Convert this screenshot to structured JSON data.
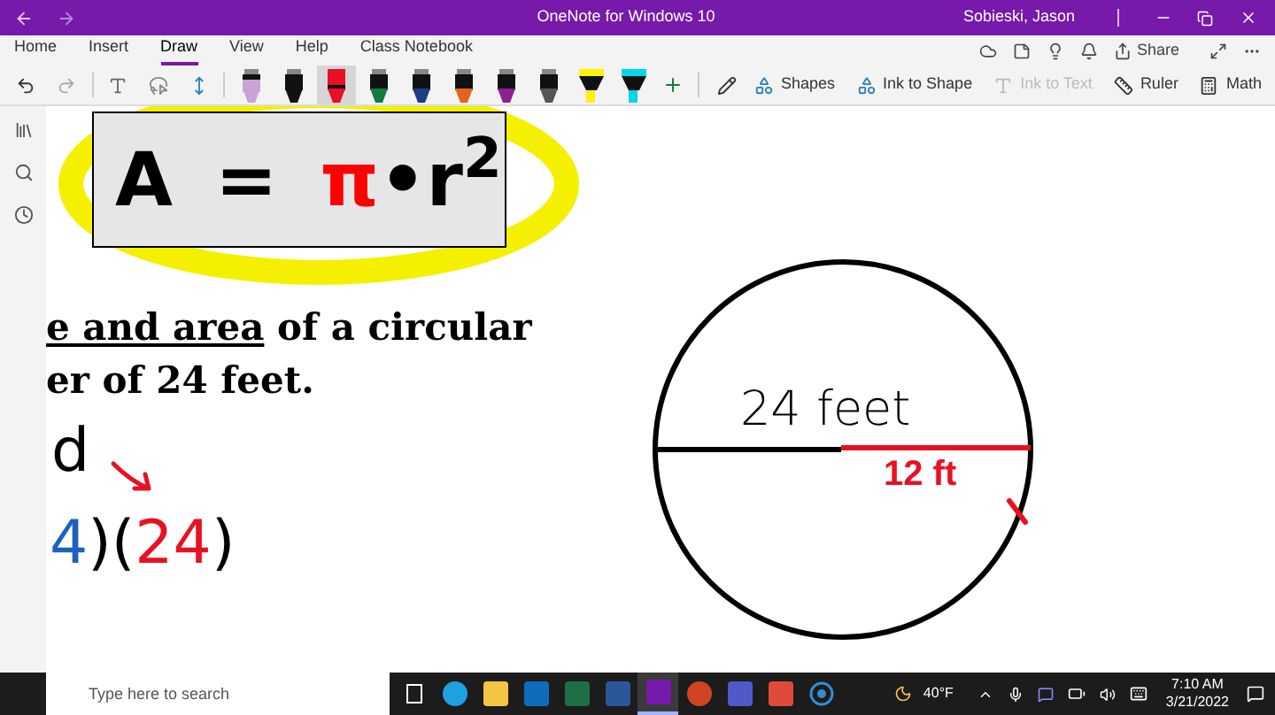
{
  "window": {
    "title": "OneNote for Windows 10",
    "user": "Sobieski, Jason"
  },
  "tabs": [
    {
      "label": "Home",
      "selected": false
    },
    {
      "label": "Insert",
      "selected": false
    },
    {
      "label": "Draw",
      "selected": true
    },
    {
      "label": "View",
      "selected": false
    },
    {
      "label": "Help",
      "selected": false
    },
    {
      "label": "Class Notebook",
      "selected": false
    }
  ],
  "share": {
    "label": "Share"
  },
  "pens": [
    {
      "kind": "pen",
      "color": "#c9a3d6",
      "selected": false
    },
    {
      "kind": "pen",
      "color": "#111111",
      "selected": false
    },
    {
      "kind": "pen",
      "color": "#e81123",
      "selected": true
    },
    {
      "kind": "pen",
      "color": "#107c41",
      "selected": false
    },
    {
      "kind": "pen",
      "color": "#1f3c88",
      "selected": false
    },
    {
      "kind": "pen",
      "color": "#e8631a",
      "selected": false
    },
    {
      "kind": "pen",
      "color": "#8e1f8e",
      "selected": false
    },
    {
      "kind": "pen",
      "color": "#555555",
      "selected": false
    },
    {
      "kind": "highlighter",
      "color": "#fff200",
      "selected": false
    },
    {
      "kind": "highlighter",
      "color": "#00d7e8",
      "selected": false
    }
  ],
  "tools": [
    {
      "label": "Shapes",
      "disabled": false
    },
    {
      "label": "Ink to Shape",
      "disabled": false
    },
    {
      "label": "Ink to Text",
      "disabled": true
    },
    {
      "label": "Ruler",
      "disabled": false
    },
    {
      "label": "Math",
      "disabled": false
    }
  ],
  "formula": {
    "left": "A",
    "equals": "=",
    "pi": "π",
    "rest": "•r$^{2}$"
  },
  "problem": {
    "line1_underlined": "e and area",
    "line1_rest": " of a circular",
    "line2": "er of 24 feet."
  },
  "handwriting": [
    {
      "text": "d",
      "color": "#000000"
    },
    {
      "text": "4",
      "color": "#1f5fbf"
    },
    {
      "text": ")(",
      "color": "#000000"
    },
    {
      "text": "24",
      "color": "#e81123"
    },
    {
      "text": ")",
      "color": "#000000"
    }
  ],
  "circle": {
    "diameter_label": "24 feet",
    "radius_label": "12 ft"
  },
  "taskbar": {
    "search_placeholder": "Type here to search",
    "temperature": "40°F",
    "time": "7:10 AM",
    "date": "3/21/2022",
    "apps": [
      {
        "kind": "taskview",
        "active": false
      },
      {
        "kind": "edge",
        "active": false
      },
      {
        "kind": "explorer",
        "active": false
      },
      {
        "kind": "outlook",
        "active": false
      },
      {
        "kind": "excel",
        "active": false
      },
      {
        "kind": "word",
        "active": false
      },
      {
        "kind": "onenote",
        "active": true
      },
      {
        "kind": "powerpoint",
        "active": false
      },
      {
        "kind": "teams",
        "active": false
      },
      {
        "kind": "redapp",
        "active": false
      },
      {
        "kind": "recorder",
        "active": false
      }
    ]
  }
}
